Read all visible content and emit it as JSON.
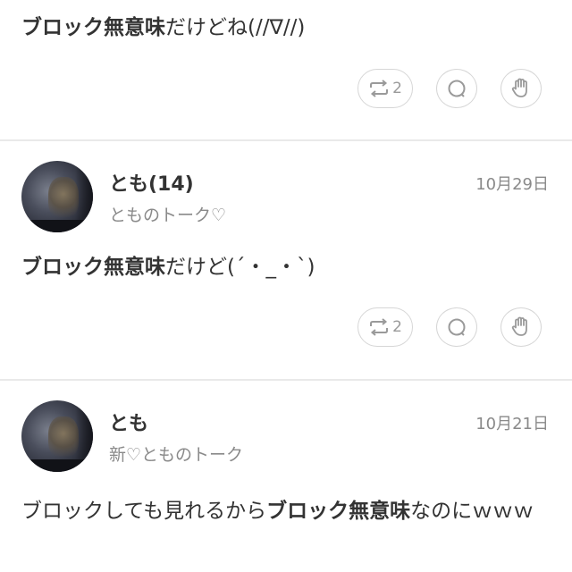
{
  "posts": [
    {
      "text_parts": [
        {
          "text": "ブロック無意味",
          "bold": true
        },
        {
          "text": "だけどね(//∇//)",
          "bold": false
        }
      ],
      "share_count": "2"
    },
    {
      "username": "とも(14)",
      "date": "10月29日",
      "subtitle": "とものトーク♡",
      "text_parts": [
        {
          "text": "ブロック無意味",
          "bold": true
        },
        {
          "text": "だけど(´・_・`)",
          "bold": false
        }
      ],
      "share_count": "2"
    },
    {
      "username": "とも",
      "date": "10月21日",
      "subtitle": "新♡とものトーク",
      "text_parts": [
        {
          "text": "ブロックしても見れるから",
          "bold": false
        },
        {
          "text": "ブロック無意味",
          "bold": true
        },
        {
          "text": "なのにｗｗｗ",
          "bold": false
        }
      ]
    }
  ],
  "icons": {
    "share": "repost-icon",
    "comment": "comment-icon",
    "like": "glove-icon"
  }
}
